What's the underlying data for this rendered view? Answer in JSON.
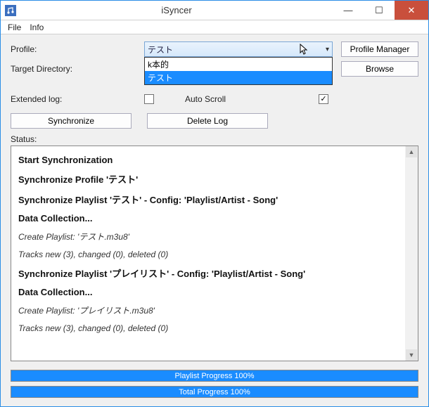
{
  "window": {
    "title": "iSyncer"
  },
  "menu": {
    "file": "File",
    "info": "Info"
  },
  "labels": {
    "profile": "Profile:",
    "target_dir": "Target Directory:",
    "extended_log": "Extended log:",
    "auto_scroll": "Auto Scroll",
    "status": "Status:"
  },
  "profile": {
    "selected": "テスト",
    "options": [
      "k本的",
      "テスト"
    ]
  },
  "buttons": {
    "profile_manager": "Profile Manager",
    "browse": "Browse",
    "synchronize": "Synchronize",
    "delete_log": "Delete Log"
  },
  "checkboxes": {
    "extended_log": false,
    "auto_scroll": true
  },
  "status_lines": [
    {
      "text": "Start Synchronization",
      "style": "bold"
    },
    {
      "text": "Synchronize Profile 'テスト'",
      "style": "bold"
    },
    {
      "text": "Synchronize Playlist 'テスト' - Config: 'Playlist/Artist - Song'",
      "style": "bold"
    },
    {
      "text": "Data Collection...",
      "style": "bold"
    },
    {
      "text": "Create Playlist: 'テスト.m3u8'",
      "style": "italic"
    },
    {
      "text": "Tracks new (3), changed (0), deleted (0)",
      "style": "italic"
    },
    {
      "text": "Synchronize Playlist 'プレイリスト' - Config: 'Playlist/Artist - Song'",
      "style": "bold"
    },
    {
      "text": "Data Collection...",
      "style": "bold"
    },
    {
      "text": "Create Playlist: 'プレイリスト.m3u8'",
      "style": "italic"
    },
    {
      "text": "Tracks new (3), changed (0), deleted (0)",
      "style": "italic"
    }
  ],
  "progress": {
    "playlist": "Playlist Progress 100%",
    "total": "Total Progress 100%"
  }
}
